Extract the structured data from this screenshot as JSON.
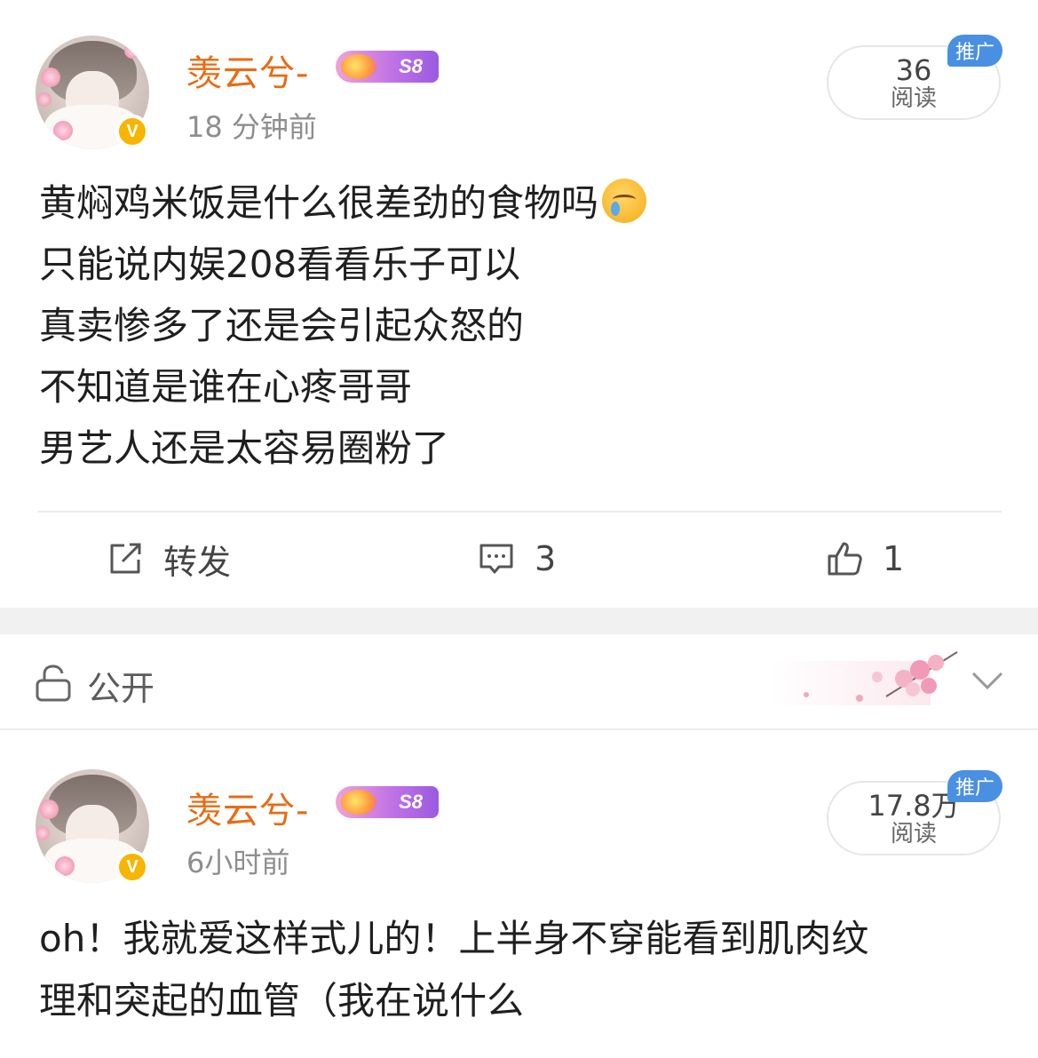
{
  "posts": [
    {
      "username": "羡云兮-",
      "level_badge": "S8",
      "time": "18 分钟前",
      "reads_count": "36",
      "reads_label": "阅读",
      "promo_tag": "推广",
      "lines": [
        "黄焖鸡米饭是什么很差劲的食物吗",
        "只能说内娱208看看乐子可以",
        "真卖惨多了还是会引起众怒的",
        "不知道是谁在心疼哥哥",
        "男艺人还是太容易圈粉了"
      ],
      "actions": {
        "repost_label": "转发",
        "comments_count": "3",
        "likes_count": "1"
      }
    },
    {
      "username": "羡云兮-",
      "level_badge": "S8",
      "time": "6小时前",
      "reads_count": "17.8万",
      "reads_label": "阅读",
      "promo_tag": "推广",
      "lines": [
        "oh！我就爱这样式儿的！上半身不穿能看到肌肉纹",
        "理和突起的血管（我在说什么"
      ]
    }
  ],
  "visibility": {
    "label": "公开"
  },
  "icons": {
    "verified": "verified-v-icon",
    "crying_emoji": "crying-face-emoji",
    "repost": "repost-icon",
    "comment": "comment-icon",
    "like": "thumbs-up-icon",
    "lock": "unlock-icon",
    "chevron": "chevron-down-icon"
  },
  "colors": {
    "username": "#e86b13",
    "promo": "#4a90e2",
    "verified": "#f7b500",
    "separator": "#f1f1f1"
  }
}
